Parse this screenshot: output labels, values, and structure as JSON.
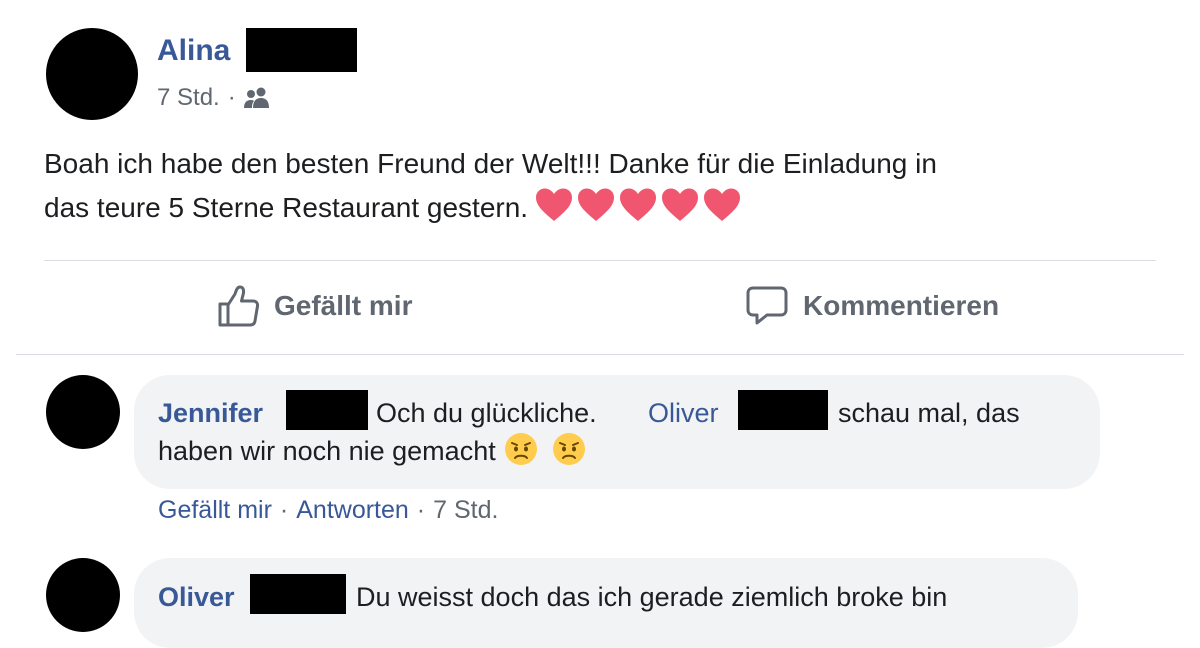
{
  "post": {
    "author": "Alina",
    "time": "7 Std.",
    "separator": "·",
    "audience_icon": "friends-icon",
    "text_line1": "Boah ich habe den besten Freund der Welt!!! Danke für die Einladung in",
    "text_line2": "das teure 5 Sterne Restaurant gestern.",
    "heart_color": "#f0566f"
  },
  "actions": {
    "like_label": "Gefällt mir",
    "comment_label": "Kommentieren",
    "like_icon": "thumbs-up-icon",
    "comment_icon": "speech-bubble-icon"
  },
  "comments": [
    {
      "author": "Jennifer",
      "text_part1": "Och du glückliche.",
      "mention": "Oliver",
      "text_part2": "schau mal, das",
      "text_line2": "haben wir noch nie gemacht",
      "emoji_icon": "worried-face-icon",
      "like_label": "Gefällt mir",
      "reply_label": "Antworten",
      "time": "7 Std.",
      "separator": "·"
    },
    {
      "author": "Oliver",
      "text": "Du weisst doch das ich gerade ziemlich broke bin"
    }
  ],
  "colors": {
    "link_blue": "#385898",
    "meta_gray": "#606770",
    "bubble_bg": "#f2f3f5",
    "divider": "#dadde1"
  }
}
